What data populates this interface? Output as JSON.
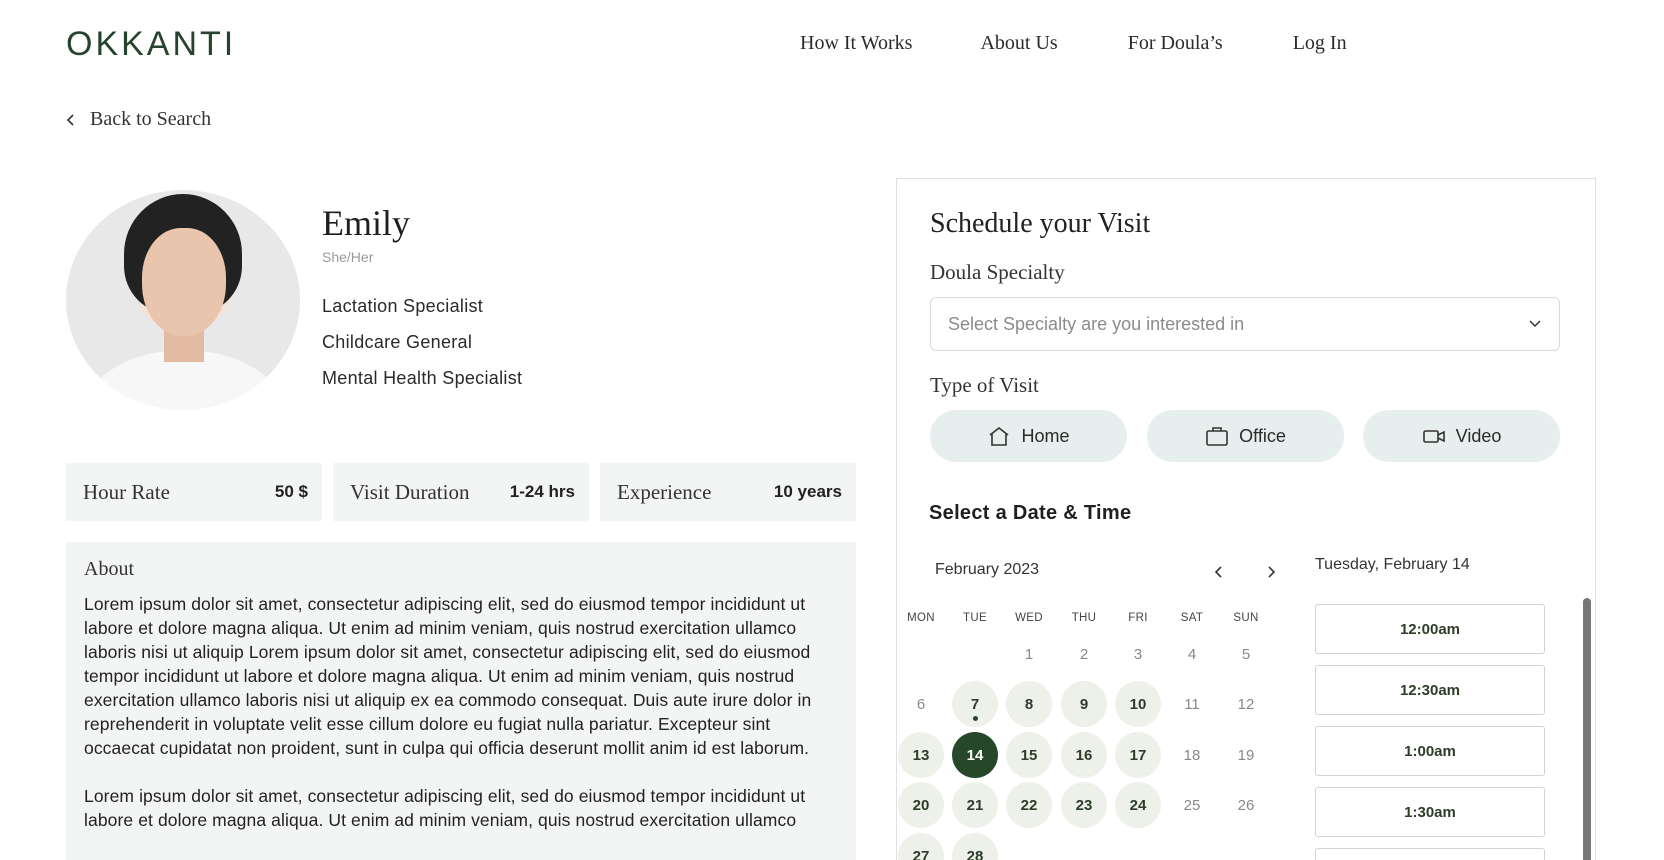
{
  "brand": {
    "logo": "OKKANTI"
  },
  "nav": {
    "items": [
      "How It Works",
      "About Us",
      "For Doula’s",
      "Log In"
    ]
  },
  "back": {
    "label": "Back to Search"
  },
  "profile": {
    "name": "Emily",
    "pronouns": "She/Her",
    "specialties": [
      "Lactation Specialist",
      "Childcare General",
      "Mental Health Specialist"
    ]
  },
  "stats": [
    {
      "label": "Hour Rate",
      "value": "50 $"
    },
    {
      "label": "Visit Duration",
      "value": "1-24 hrs"
    },
    {
      "label": "Experience",
      "value": "10 years"
    }
  ],
  "about": {
    "title": "About",
    "paragraphs": [
      "Lorem ipsum dolor sit amet, consectetur adipiscing elit, sed do eiusmod tempor incididunt ut labore et dolore magna aliqua. Ut enim ad minim veniam, quis nostrud exercitation ullamco laboris nisi ut aliquip Lorem ipsum dolor sit amet, consectetur adipiscing elit, sed do eiusmod tempor incididunt ut labore et dolore magna aliqua. Ut enim ad minim veniam, quis nostrud exercitation ullamco laboris nisi ut aliquip ex ea commodo consequat. Duis aute irure dolor in reprehenderit in voluptate velit esse cillum dolore eu fugiat nulla pariatur. Excepteur sint occaecat cupidatat non proident, sunt in culpa qui officia deserunt mollit anim id est laborum.",
      "Lorem ipsum dolor sit amet, consectetur adipiscing elit, sed do eiusmod tempor incididunt ut labore et dolore magna aliqua. Ut enim ad minim veniam, quis nostrud exercitation ullamco"
    ]
  },
  "schedule": {
    "title": "Schedule your Visit",
    "specialty_label": "Doula Specialty",
    "specialty_placeholder": "Select Specialty are you interested in",
    "visit_type_label": "Type of Visit",
    "visit_types": [
      {
        "label": "Home",
        "icon": "home-icon"
      },
      {
        "label": "Office",
        "icon": "briefcase-icon"
      },
      {
        "label": "Video",
        "icon": "video-camera-icon"
      }
    ],
    "date_time_title": "Select a Date & Time",
    "calendar": {
      "month": "February 2023",
      "weekdays": [
        "MON",
        "TUE",
        "WED",
        "THU",
        "FRI",
        "SAT",
        "SUN"
      ],
      "weeks": [
        [
          null,
          null,
          "1",
          "2",
          "3",
          "4",
          "5"
        ],
        [
          "6",
          "7",
          "8",
          "9",
          "10",
          "11",
          "12"
        ],
        [
          "13",
          "14",
          "15",
          "16",
          "17",
          "18",
          "19"
        ],
        [
          "20",
          "21",
          "22",
          "23",
          "24",
          "25",
          "26"
        ],
        [
          "27",
          "28",
          null,
          null,
          null,
          null,
          null
        ]
      ],
      "available": [
        "7",
        "8",
        "9",
        "10",
        "13",
        "14",
        "15",
        "16",
        "17",
        "20",
        "21",
        "22",
        "23",
        "24",
        "27",
        "28"
      ],
      "selected": "14",
      "today": "7"
    },
    "selected_date_label": "Tuesday, February 14",
    "time_slots": [
      "12:00am",
      "12:30am",
      "1:00am",
      "1:30am",
      ""
    ]
  },
  "colors": {
    "brand_green": "#27472b",
    "chip_bg": "#e7eeee",
    "panel_bg": "#f3f4f4"
  }
}
